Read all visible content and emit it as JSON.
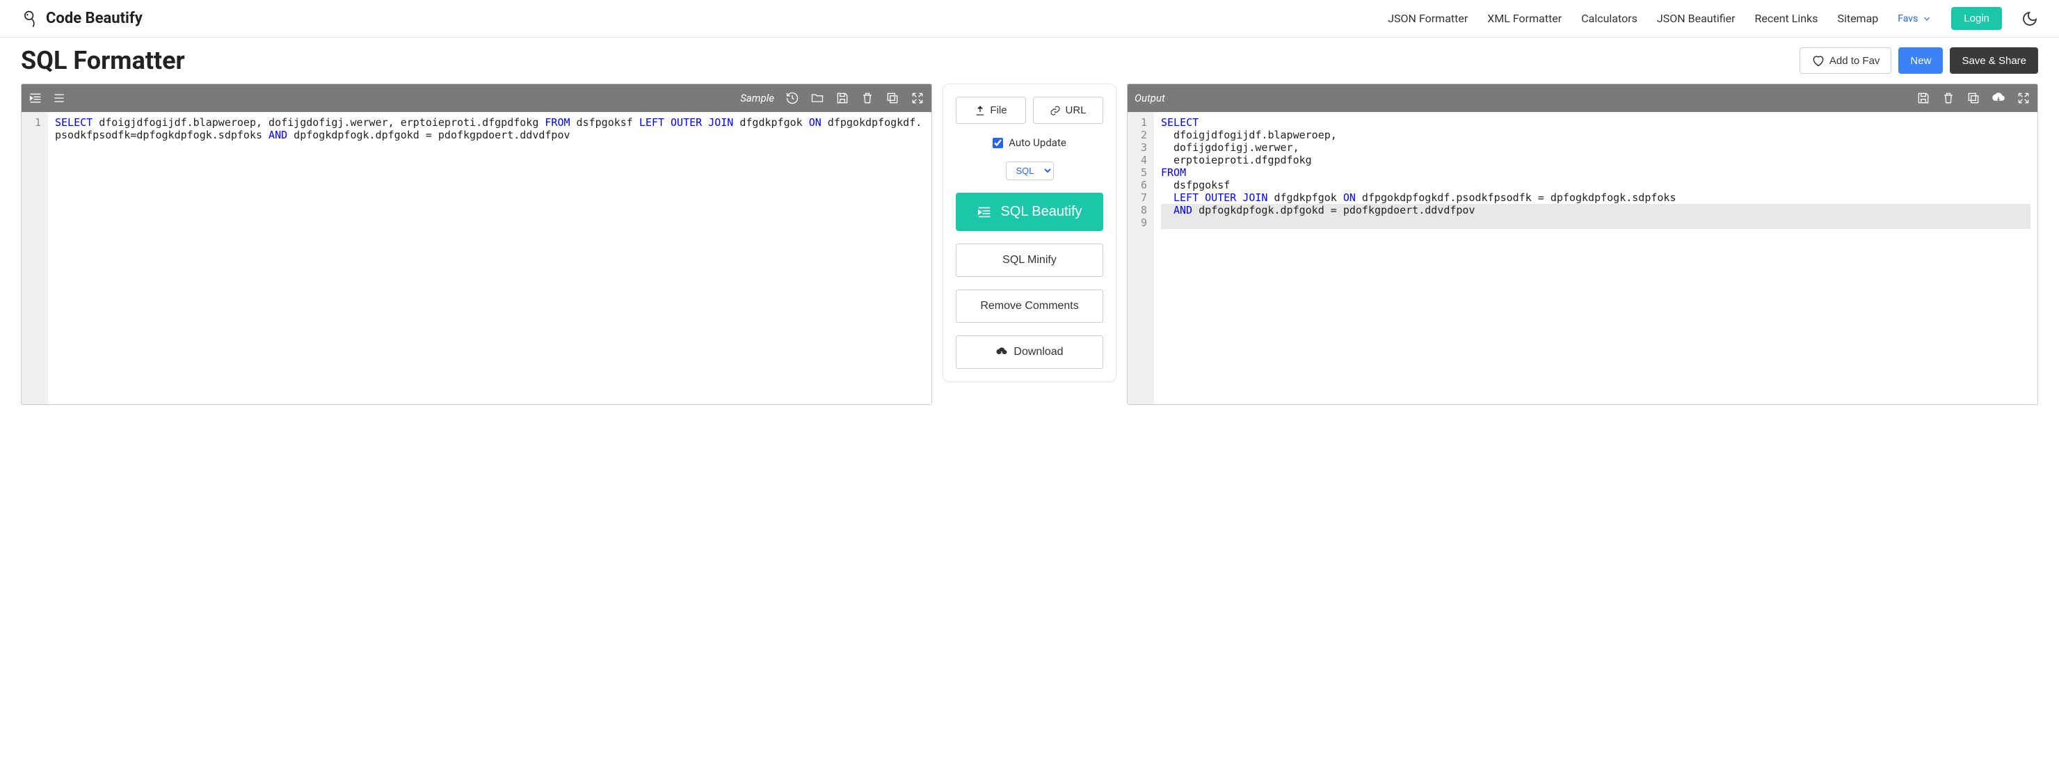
{
  "header": {
    "brand": "Code Beautify",
    "nav": [
      "JSON Formatter",
      "XML Formatter",
      "Calculators",
      "JSON Beautifier",
      "Recent Links",
      "Sitemap"
    ],
    "favs": "Favs",
    "login": "Login"
  },
  "page": {
    "title": "SQL Formatter",
    "add_to_fav": "Add to Fav",
    "new": "New",
    "save_share": "Save & Share"
  },
  "left_toolbar": {
    "sample": "Sample"
  },
  "right_toolbar": {
    "output": "Output"
  },
  "center": {
    "file": "File",
    "url": "URL",
    "auto_update": "Auto Update",
    "lang": "SQL",
    "beautify": "SQL Beautify",
    "minify": "SQL Minify",
    "remove_comments": "Remove Comments",
    "download": "Download"
  },
  "input_code": {
    "line_numbers": [
      "1"
    ],
    "tokens": [
      {
        "t": "SELECT",
        "kw": true
      },
      {
        "t": " dfoigjdfogijdf.blapweroep, dofijgdofigj.werwer, erptoieproti.dfgpdfokg ",
        "kw": false
      },
      {
        "t": "FROM",
        "kw": true
      },
      {
        "t": " dsfpgoksf ",
        "kw": false
      },
      {
        "t": "LEFT OUTER JOIN",
        "kw": true
      },
      {
        "t": " dfgdkpfgok ",
        "kw": false
      },
      {
        "t": "ON",
        "kw": true
      },
      {
        "t": " dfpgokdpfogkdf.psodkfpsodfk=dpfogkdpfogk.sdpfoks ",
        "kw": false
      },
      {
        "t": "AND",
        "kw": true
      },
      {
        "t": " dpfogkdpfogk.dpfgokd = pdofkgpdoert.ddvdfpov",
        "kw": false
      }
    ]
  },
  "output_code": {
    "line_numbers": [
      "1",
      "2",
      "3",
      "4",
      "5",
      "6",
      "7",
      "8",
      "9"
    ],
    "lines": [
      {
        "indent": 0,
        "tokens": [
          {
            "t": "SELECT",
            "kw": true
          }
        ]
      },
      {
        "indent": 1,
        "tokens": [
          {
            "t": "dfoigjdfogijdf.blapweroep,",
            "kw": false
          }
        ]
      },
      {
        "indent": 1,
        "tokens": [
          {
            "t": "dofijgdofigj.werwer,",
            "kw": false
          }
        ]
      },
      {
        "indent": 1,
        "tokens": [
          {
            "t": "erptoieproti.dfgpdfokg",
            "kw": false
          }
        ]
      },
      {
        "indent": 0,
        "tokens": [
          {
            "t": "FROM",
            "kw": true
          }
        ]
      },
      {
        "indent": 1,
        "tokens": [
          {
            "t": "dsfpgoksf",
            "kw": false
          }
        ]
      },
      {
        "indent": 1,
        "tokens": [
          {
            "t": "LEFT OUTER JOIN",
            "kw": true
          },
          {
            "t": " dfgdkpfgok ",
            "kw": false
          },
          {
            "t": "ON",
            "kw": true
          },
          {
            "t": " dfpgokdpfogkdf.psodkfpsodfk = dpfogkdpfogk.sdpfoks",
            "kw": false
          }
        ]
      },
      {
        "indent": 1,
        "highlighted": true,
        "tokens": [
          {
            "t": "AND",
            "kw": true
          },
          {
            "t": " dpfogkdpfogk.dpfgokd = pdofkgpdoert.ddvdfpov",
            "kw": false
          }
        ]
      },
      {
        "indent": 0,
        "highlighted": true,
        "tokens": []
      }
    ]
  }
}
